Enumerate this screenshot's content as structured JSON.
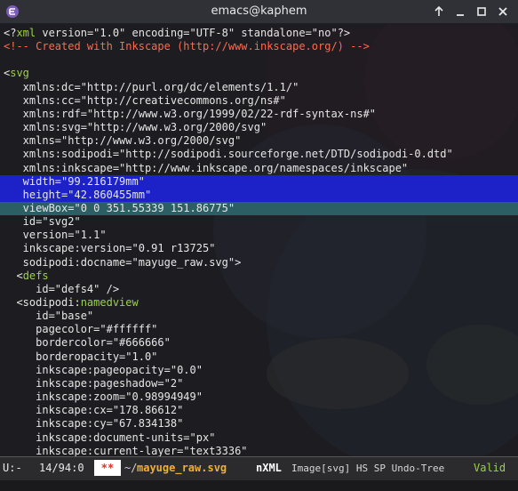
{
  "window": {
    "title": "emacs@kaphem",
    "controls": [
      "arrow-up-icon",
      "minimize-icon",
      "maximize-icon",
      "close-icon"
    ]
  },
  "colors": {
    "tag": "#9bd14b",
    "keyword": "#d9e33a",
    "comment": "#ff6a4d",
    "region": "#1d22c8",
    "current_line": "#2c5f64",
    "modified_flag": "#e0322b"
  },
  "lines": [
    {
      "hl": "",
      "segs": [
        [
          "w",
          "<?"
        ],
        [
          "g",
          "xml"
        ],
        [
          "w",
          " version=\"1.0\" encoding=\"UTF-8\" standalone=\"no\"?>"
        ]
      ]
    },
    {
      "hl": "",
      "segs": [
        [
          "r",
          "<!-- Created with Inkscape (http://www.inkscape.org/) -->"
        ]
      ]
    },
    {
      "hl": "",
      "segs": [
        [
          "w",
          ""
        ]
      ]
    },
    {
      "hl": "",
      "segs": [
        [
          "w",
          "<"
        ],
        [
          "g",
          "svg"
        ]
      ]
    },
    {
      "hl": "",
      "segs": [
        [
          "w",
          "   xmlns:dc=\"http://purl.org/dc/elements/1.1/\""
        ]
      ]
    },
    {
      "hl": "",
      "segs": [
        [
          "w",
          "   xmlns:cc=\"http://creativecommons.org/ns#\""
        ]
      ]
    },
    {
      "hl": "",
      "segs": [
        [
          "w",
          "   xmlns:rdf=\"http://www.w3.org/1999/02/22-rdf-syntax-ns#\""
        ]
      ]
    },
    {
      "hl": "",
      "segs": [
        [
          "w",
          "   xmlns:svg=\"http://www.w3.org/2000/svg\""
        ]
      ]
    },
    {
      "hl": "",
      "segs": [
        [
          "w",
          "   xmlns=\"http://www.w3.org/2000/svg\""
        ]
      ]
    },
    {
      "hl": "",
      "segs": [
        [
          "w",
          "   xmlns:sodipodi=\"http://sodipodi.sourceforge.net/DTD/sodipodi-0.dtd\""
        ]
      ]
    },
    {
      "hl": "",
      "segs": [
        [
          "w",
          "   xmlns:inkscape=\"http://www.inkscape.org/namespaces/inkscape\""
        ]
      ]
    },
    {
      "hl": "blue",
      "segs": [
        [
          "w",
          "   width=\"99.216179mm\""
        ]
      ]
    },
    {
      "hl": "blue",
      "segs": [
        [
          "w",
          "   height=\"42.860455mm\""
        ]
      ]
    },
    {
      "hl": "teal",
      "segs": [
        [
          "w",
          "   viewBox=\"0 0 351.55339 151.86775\""
        ]
      ]
    },
    {
      "hl": "",
      "segs": [
        [
          "w",
          "   id=\"svg2\""
        ]
      ]
    },
    {
      "hl": "",
      "segs": [
        [
          "w",
          "   version=\"1.1\""
        ]
      ]
    },
    {
      "hl": "",
      "segs": [
        [
          "w",
          "   inkscape:version=\"0.91 r13725\""
        ]
      ]
    },
    {
      "hl": "",
      "segs": [
        [
          "w",
          "   sodipodi:docname=\"mayuge_raw.svg\">"
        ]
      ]
    },
    {
      "hl": "",
      "segs": [
        [
          "w",
          "  <"
        ],
        [
          "g",
          "defs"
        ]
      ]
    },
    {
      "hl": "",
      "segs": [
        [
          "w",
          "     id=\"defs4\" />"
        ]
      ]
    },
    {
      "hl": "",
      "segs": [
        [
          "w",
          "  <sodipodi:"
        ],
        [
          "g",
          "namedview"
        ]
      ]
    },
    {
      "hl": "",
      "segs": [
        [
          "w",
          "     id=\"base\""
        ]
      ]
    },
    {
      "hl": "",
      "segs": [
        [
          "w",
          "     pagecolor=\"#ffffff\""
        ]
      ]
    },
    {
      "hl": "",
      "segs": [
        [
          "w",
          "     bordercolor=\"#666666\""
        ]
      ]
    },
    {
      "hl": "",
      "segs": [
        [
          "w",
          "     borderopacity=\"1.0\""
        ]
      ]
    },
    {
      "hl": "",
      "segs": [
        [
          "w",
          "     inkscape:pageopacity=\"0.0\""
        ]
      ]
    },
    {
      "hl": "",
      "segs": [
        [
          "w",
          "     inkscape:pageshadow=\"2\""
        ]
      ]
    },
    {
      "hl": "",
      "segs": [
        [
          "w",
          "     inkscape:zoom=\"0.98994949\""
        ]
      ]
    },
    {
      "hl": "",
      "segs": [
        [
          "w",
          "     inkscape:cx=\"178.86612\""
        ]
      ]
    },
    {
      "hl": "",
      "segs": [
        [
          "w",
          "     inkscape:cy=\"67.834138\""
        ]
      ]
    },
    {
      "hl": "",
      "segs": [
        [
          "w",
          "     inkscape:document-units=\"px\""
        ]
      ]
    },
    {
      "hl": "",
      "segs": [
        [
          "w",
          "     inkscape:current-layer=\"text3336\""
        ]
      ]
    }
  ],
  "modeline": {
    "encoding_state": "U:-",
    "position": "14/94:0",
    "modified": "**",
    "dir_prefix": "~/",
    "buffer_name": "mayuge_raw.svg",
    "major_mode": "nXML",
    "minor_modes": "Image[svg] HS SP Undo-Tree",
    "validity": "Valid"
  }
}
